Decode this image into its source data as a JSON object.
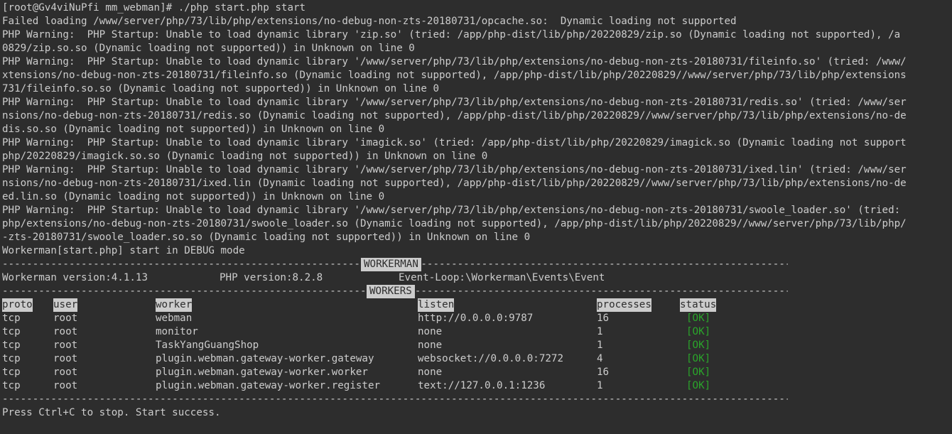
{
  "output_lines": [
    "[root@Gv4viNuPfi mm_webman]# ./php start.php start",
    "Failed loading /www/server/php/73/lib/php/extensions/no-debug-non-zts-20180731/opcache.so:  Dynamic loading not supported",
    "PHP Warning:  PHP Startup: Unable to load dynamic library 'zip.so' (tried: /app/php-dist/lib/php/20220829/zip.so (Dynamic loading not supported), /a",
    "0829/zip.so.so (Dynamic loading not supported)) in Unknown on line 0",
    "PHP Warning:  PHP Startup: Unable to load dynamic library '/www/server/php/73/lib/php/extensions/no-debug-non-zts-20180731/fileinfo.so' (tried: /www/",
    "xtensions/no-debug-non-zts-20180731/fileinfo.so (Dynamic loading not supported), /app/php-dist/lib/php/20220829//www/server/php/73/lib/php/extensions",
    "731/fileinfo.so.so (Dynamic loading not supported)) in Unknown on line 0",
    "PHP Warning:  PHP Startup: Unable to load dynamic library '/www/server/php/73/lib/php/extensions/no-debug-non-zts-20180731/redis.so' (tried: /www/ser",
    "nsions/no-debug-non-zts-20180731/redis.so (Dynamic loading not supported), /app/php-dist/lib/php/20220829//www/server/php/73/lib/php/extensions/no-de",
    "dis.so.so (Dynamic loading not supported)) in Unknown on line 0",
    "PHP Warning:  PHP Startup: Unable to load dynamic library 'imagick.so' (tried: /app/php-dist/lib/php/20220829/imagick.so (Dynamic loading not support",
    "php/20220829/imagick.so.so (Dynamic loading not supported)) in Unknown on line 0",
    "PHP Warning:  PHP Startup: Unable to load dynamic library '/www/server/php/73/lib/php/extensions/no-debug-non-zts-20180731/ixed.lin' (tried: /www/ser",
    "nsions/no-debug-non-zts-20180731/ixed.lin (Dynamic loading not supported), /app/php-dist/lib/php/20220829//www/server/php/73/lib/php/extensions/no-de",
    "ed.lin.so (Dynamic loading not supported)) in Unknown on line 0",
    "PHP Warning:  PHP Startup: Unable to load dynamic library '/www/server/php/73/lib/php/extensions/no-debug-non-zts-20180731/swoole_loader.so' (tried: ",
    "php/extensions/no-debug-non-zts-20180731/swoole_loader.so (Dynamic loading not supported), /app/php-dist/lib/php/20220829//www/server/php/73/lib/php/",
    "-zts-20180731/swoole_loader.so.so (Dynamic loading not supported)) in Unknown on line 0",
    "Workerman[start.php] start in DEBUG mode"
  ],
  "dash_line": "-------------------------------------------------------------------------------------------------------------------------------------------------------------------------",
  "banner_workerman": "WORKERMAN",
  "info": {
    "workerman_version": "Workerman version:4.1.13",
    "php_version": "PHP version:8.2.8",
    "event_loop": "Event-Loop:\\Workerman\\Events\\Event"
  },
  "banner_workers": "WORKERS",
  "table": {
    "headers": [
      "proto",
      "user",
      "worker",
      "listen",
      "processes",
      "status"
    ],
    "rows": [
      [
        "tcp",
        "root",
        "webman",
        "http://0.0.0.0:9787",
        "16",
        "[OK]"
      ],
      [
        "tcp",
        "root",
        "monitor",
        "none",
        "1",
        "[OK]"
      ],
      [
        "tcp",
        "root",
        "TaskYangGuangShop",
        "none",
        "1",
        "[OK]"
      ],
      [
        "tcp",
        "root",
        "plugin.webman.gateway-worker.gateway",
        "websocket://0.0.0.0:7272",
        "4",
        "[OK]"
      ],
      [
        "tcp",
        "root",
        "plugin.webman.gateway-worker.worker",
        "none",
        "16",
        "[OK]"
      ],
      [
        "tcp",
        "root",
        "plugin.webman.gateway-worker.register",
        "text://127.0.0.1:1236",
        "1",
        "[OK]"
      ]
    ]
  },
  "footer": "Press Ctrl+C to stop. Start success.",
  "colors": {
    "background": "#2d2d2d",
    "foreground": "#cccccc",
    "ok": "#2aa52a"
  }
}
